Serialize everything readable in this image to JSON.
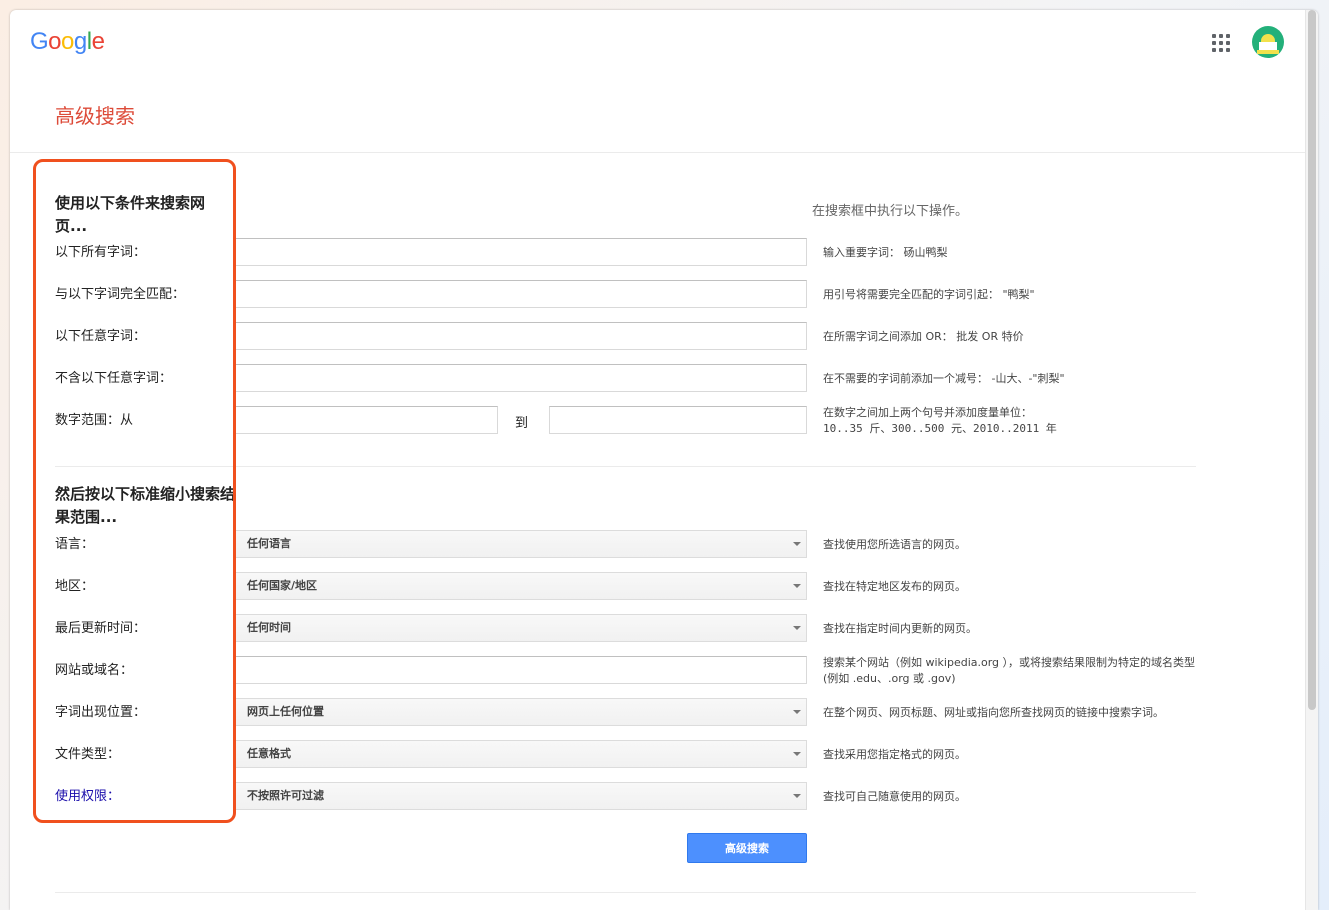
{
  "header": {
    "logo": {
      "letters": [
        "G",
        "o",
        "o",
        "g",
        "l",
        "e"
      ],
      "colors": [
        "#4285f4",
        "#ea4335",
        "#fbbc05",
        "#4285f4",
        "#34a853",
        "#ea4335"
      ]
    },
    "apps_icon": "apps-grid-icon",
    "avatar_icon": "avatar-icon"
  },
  "page_title": "高级搜索",
  "section1": {
    "title": "使用以下条件来搜索网页...",
    "hint_header": "在搜索框中执行以下操作。",
    "rows": [
      {
        "label": "以下所有字词：",
        "value": "",
        "hint": "输入重要字词： 砀山鸭梨"
      },
      {
        "label": "与以下字词完全匹配：",
        "value": "",
        "hint": "用引号将需要完全匹配的字词引起： \"鸭梨\""
      },
      {
        "label": "以下任意字词：",
        "value": "",
        "hint": "在所需字词之间添加 OR： 批发 OR 特价"
      },
      {
        "label": "不含以下任意字词：",
        "value": "",
        "hint": "在不需要的字词前添加一个减号： -山大、-\"刺梨\""
      }
    ],
    "range": {
      "label": "数字范围：从",
      "to": "到",
      "from_value": "",
      "to_value": "",
      "hint_line1": "在数字之间加上两个句号并添加度量单位：",
      "hint_line2": "10..35 斤、300..500 元、2010..2011 年"
    }
  },
  "section2": {
    "title": "然后按以下标准缩小搜索结果范围...",
    "rows": [
      {
        "label": "语言：",
        "value": "任何语言",
        "hint": "查找使用您所选语言的网页。"
      },
      {
        "label": "地区：",
        "value": "任何国家/地区",
        "hint": "查找在特定地区发布的网页。"
      },
      {
        "label": "最后更新时间：",
        "value": "任何时间",
        "hint": "查找在指定时间内更新的网页。"
      },
      {
        "label": "网站或域名：",
        "value": "",
        "hint": "搜索某个网站（例如 wikipedia.org ），或将搜索结果限制为特定的域名类型(例如 .edu、.org 或 .gov)"
      },
      {
        "label": "字词出现位置：",
        "value": "网页上任何位置",
        "hint": "在整个网页、网页标题、网址或指向您所查找网页的链接中搜索字词。"
      },
      {
        "label": "文件类型：",
        "value": "任意格式",
        "hint": "查找采用您指定格式的网页。"
      },
      {
        "label": "使用权限：",
        "value": "不按照许可过滤",
        "hint": "查找可自己随意使用的网页。"
      }
    ]
  },
  "submit_label": "高级搜索",
  "annotation": {
    "color": "#f0501e"
  }
}
